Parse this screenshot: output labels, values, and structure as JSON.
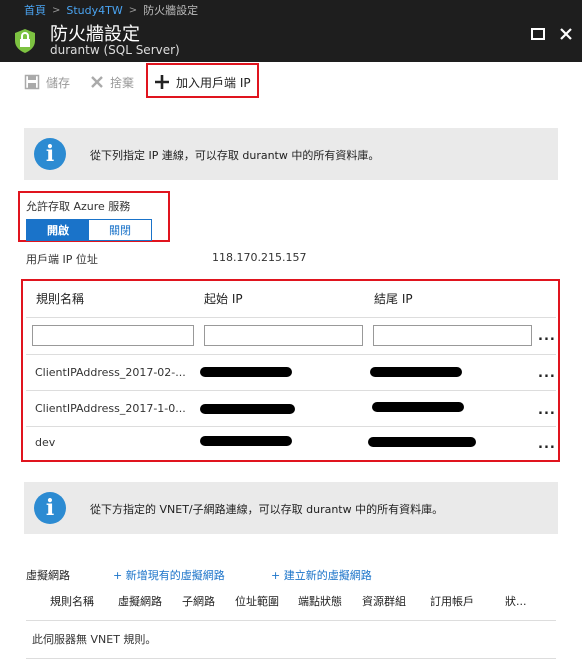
{
  "breadcrumb": {
    "home": "首頁",
    "parent": "Study4TW",
    "current": "防火牆設定"
  },
  "blade": {
    "title": "防火牆設定",
    "subtitle": "durantw (SQL Server)"
  },
  "toolbar": {
    "save": "儲存",
    "discard": "捨棄",
    "add_client_ip": "加入用戶端 IP"
  },
  "info1": "從下列指定 IP 連線，可以存取 durantw 中的所有資料庫。",
  "azure": {
    "label": "允許存取 Azure 服務",
    "on": "開啟",
    "off": "關閉"
  },
  "client_ip": {
    "label": "用戶端 IP 位址",
    "value": "118.170.215.157"
  },
  "rules_table": {
    "headers": [
      "規則名稱",
      "起始 IP",
      "結尾 IP"
    ],
    "rows": [
      {
        "name": "ClientIPAddress_2017-02-..."
      },
      {
        "name": "ClientIPAddress_2017-1-0..."
      },
      {
        "name": "dev"
      }
    ],
    "more": "..."
  },
  "info2": "從下方指定的 VNET/子網路連線，可以存取 durantw 中的所有資料庫。",
  "vnet": {
    "label": "虛擬網路",
    "add_existing": "+ 新增現有的虛擬網路",
    "create_new": "+ 建立新的虛擬網路",
    "headers": [
      "規則名稱",
      "虛擬網路",
      "子網路",
      "位址範圍",
      "端點狀態",
      "資源群組",
      "訂用帳戶",
      "狀..."
    ],
    "empty": "此伺服器無 VNET 規則。"
  },
  "colors": {
    "accent": "#1a73c9",
    "highlight": "#e0141e",
    "topbar": "#1e1e1e",
    "shield": "#7dc241"
  }
}
